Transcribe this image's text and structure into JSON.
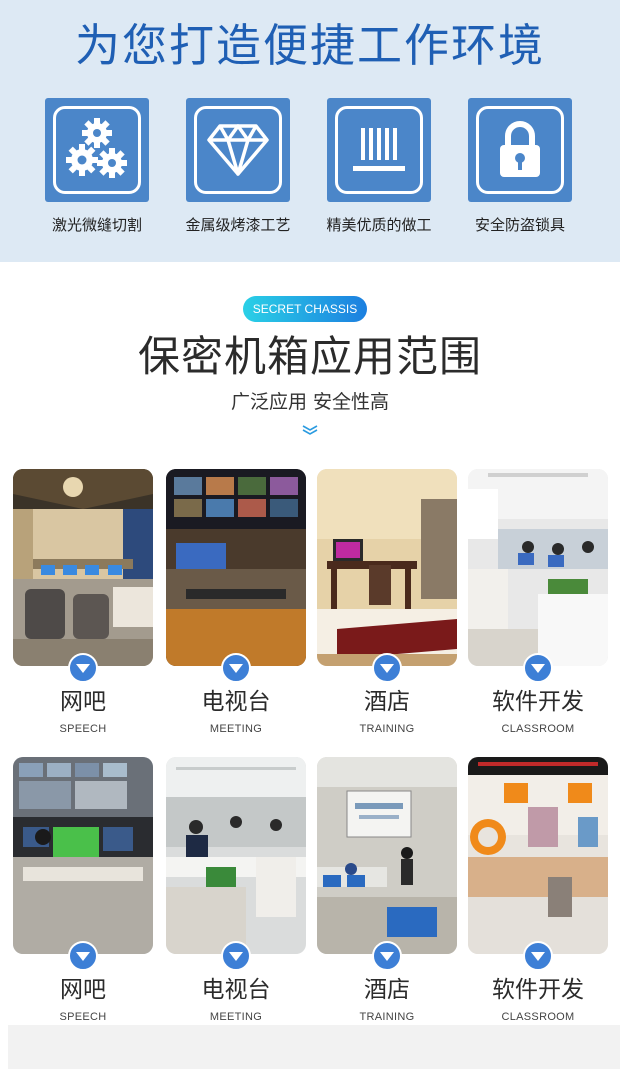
{
  "top": {
    "title": "为您打造便捷工作环境",
    "features": [
      {
        "icon": "gears-icon",
        "label": "激光微缝切割"
      },
      {
        "icon": "diamond-icon",
        "label": "金属级烤漆工艺"
      },
      {
        "icon": "grille-icon",
        "label": "精美优质的做工"
      },
      {
        "icon": "padlock-icon",
        "label": "安全防盗锁具"
      }
    ]
  },
  "section": {
    "badge": "SECRET CHASSIS",
    "title": "保密机箱应用范围",
    "subtitle": "广泛应用 安全性高",
    "chevron_icon": "double-chevron-down-icon"
  },
  "applications": [
    {
      "cn": "网吧",
      "en": "SPEECH",
      "photo": "internet-cafe-photo"
    },
    {
      "cn": "电视台",
      "en": "MEETING",
      "photo": "tv-station-photo"
    },
    {
      "cn": "酒店",
      "en": "TRAINING",
      "photo": "hotel-room-photo"
    },
    {
      "cn": "软件开发",
      "en": "CLASSROOM",
      "photo": "software-office-photo"
    },
    {
      "cn": "网吧",
      "en": "SPEECH",
      "photo": "monitoring-room-photo"
    },
    {
      "cn": "电视台",
      "en": "MEETING",
      "photo": "office-workspace-photo"
    },
    {
      "cn": "酒店",
      "en": "TRAINING",
      "photo": "training-room-photo"
    },
    {
      "cn": "软件开发",
      "en": "CLASSROOM",
      "photo": "service-counter-photo"
    }
  ],
  "colors": {
    "top_band": "#dde9f4",
    "title_blue": "#1f5fb4",
    "tile_blue": "#4b86c9",
    "pin_blue": "#3d7fd6"
  }
}
